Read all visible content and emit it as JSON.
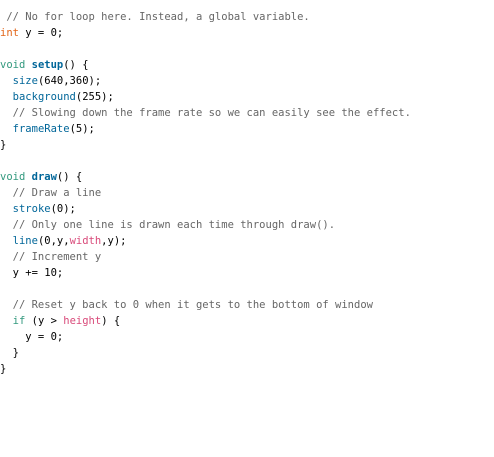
{
  "editor": {
    "lines": [
      [
        {
          "t": " // No for loop here. Instead, a global variable.",
          "c": "comment"
        }
      ],
      [
        {
          "t": "int",
          "c": "kw-type"
        },
        {
          "t": " y = 0;",
          "c": "plain"
        }
      ],
      [],
      [
        {
          "t": "void",
          "c": "kw-struct"
        },
        {
          "t": " ",
          "c": "plain"
        },
        {
          "t": "setup",
          "c": "kw-func-bold"
        },
        {
          "t": "() {",
          "c": "plain"
        }
      ],
      [
        {
          "t": "  ",
          "c": "plain"
        },
        {
          "t": "size",
          "c": "kw-func"
        },
        {
          "t": "(640,360);",
          "c": "plain"
        }
      ],
      [
        {
          "t": "  ",
          "c": "plain"
        },
        {
          "t": "background",
          "c": "kw-func"
        },
        {
          "t": "(255);",
          "c": "plain"
        }
      ],
      [
        {
          "t": "  // Slowing down the frame rate so we can easily see the effect.",
          "c": "comment"
        }
      ],
      [
        {
          "t": "  ",
          "c": "plain"
        },
        {
          "t": "frameRate",
          "c": "kw-func"
        },
        {
          "t": "(5);",
          "c": "plain"
        }
      ],
      [
        {
          "t": "}",
          "c": "plain"
        }
      ],
      [],
      [
        {
          "t": "void",
          "c": "kw-struct"
        },
        {
          "t": " ",
          "c": "plain"
        },
        {
          "t": "draw",
          "c": "kw-func-bold"
        },
        {
          "t": "() {",
          "c": "plain"
        }
      ],
      [
        {
          "t": "  // Draw a line",
          "c": "comment"
        }
      ],
      [
        {
          "t": "  ",
          "c": "plain"
        },
        {
          "t": "stroke",
          "c": "kw-func"
        },
        {
          "t": "(0);",
          "c": "plain"
        }
      ],
      [
        {
          "t": "  // Only one line is drawn each time through draw().",
          "c": "comment"
        }
      ],
      [
        {
          "t": "  ",
          "c": "plain"
        },
        {
          "t": "line",
          "c": "kw-func"
        },
        {
          "t": "(0,y,",
          "c": "plain"
        },
        {
          "t": "width",
          "c": "kw-const"
        },
        {
          "t": ",y);",
          "c": "plain"
        }
      ],
      [
        {
          "t": "  // Increment y",
          "c": "comment"
        }
      ],
      [
        {
          "t": "  y += 10;",
          "c": "plain"
        }
      ],
      [],
      [
        {
          "t": "  // Reset y back to 0 when it gets to the bottom of window",
          "c": "comment"
        }
      ],
      [
        {
          "t": "  ",
          "c": "plain"
        },
        {
          "t": "if",
          "c": "kw-struct"
        },
        {
          "t": " (y > ",
          "c": "plain"
        },
        {
          "t": "height",
          "c": "kw-const"
        },
        {
          "t": ") {",
          "c": "plain"
        }
      ],
      [
        {
          "t": "    y = 0;",
          "c": "plain"
        }
      ],
      [
        {
          "t": "  }",
          "c": "plain"
        }
      ],
      [
        {
          "t": "}",
          "c": "plain"
        }
      ]
    ]
  }
}
